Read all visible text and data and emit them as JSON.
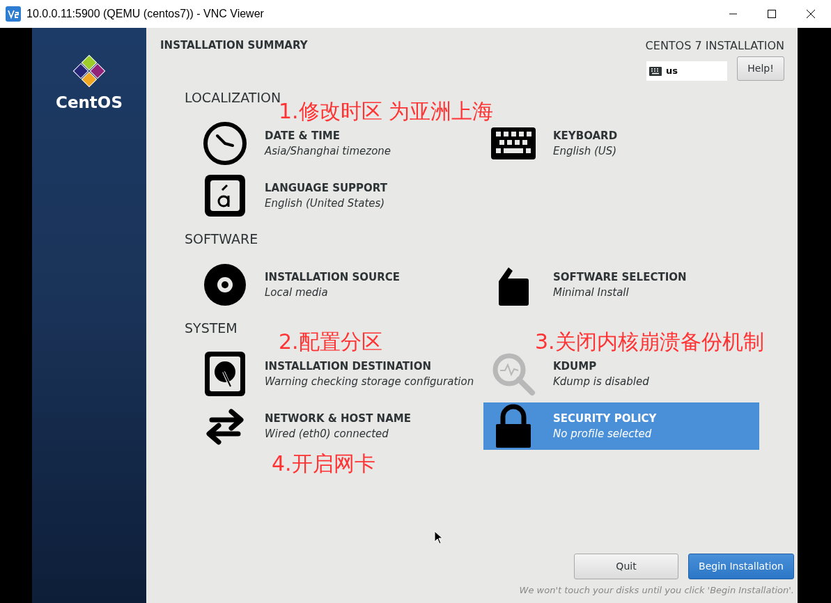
{
  "window": {
    "title": "10.0.0.11:5900 (QEMU (centos7)) - VNC Viewer"
  },
  "sidebar": {
    "logo_text": "CentOS"
  },
  "header": {
    "title": "INSTALLATION SUMMARY",
    "product": "CENTOS 7 INSTALLATION",
    "keyboard_layout": "us",
    "help_button": "Help!"
  },
  "sections": [
    {
      "heading": "LOCALIZATION",
      "items": [
        {
          "kind": "clock",
          "title": "DATE & TIME",
          "status": "Asia/Shanghai timezone",
          "disabled": false,
          "selected": false,
          "annotation": "1.修改时区 为亚洲上海"
        },
        {
          "kind": "keyboard",
          "title": "KEYBOARD",
          "status": "English (US)",
          "disabled": false,
          "selected": false
        },
        {
          "kind": "language",
          "title": "LANGUAGE SUPPORT",
          "status": "English (United States)",
          "disabled": false,
          "selected": false
        }
      ]
    },
    {
      "heading": "SOFTWARE",
      "items": [
        {
          "kind": "disc",
          "title": "INSTALLATION SOURCE",
          "status": "Local media",
          "disabled": false,
          "selected": false
        },
        {
          "kind": "package",
          "title": "SOFTWARE SELECTION",
          "status": "Minimal Install",
          "disabled": false,
          "selected": false
        }
      ]
    },
    {
      "heading": "SYSTEM",
      "items": [
        {
          "kind": "disk",
          "title": "INSTALLATION DESTINATION",
          "status": "Warning checking storage configuration",
          "disabled": false,
          "selected": false,
          "annotation": "2.配置分区"
        },
        {
          "kind": "search",
          "title": "KDUMP",
          "status": "Kdump is disabled",
          "disabled": true,
          "selected": false,
          "annotation": "3.关闭内核崩溃备份机制"
        },
        {
          "kind": "network",
          "title": "NETWORK & HOST NAME",
          "status": "Wired (eth0) connected",
          "disabled": false,
          "selected": false,
          "annotation": "4.开启网卡"
        },
        {
          "kind": "lock",
          "title": "SECURITY POLICY",
          "status": "No profile selected",
          "disabled": false,
          "selected": true
        }
      ]
    }
  ],
  "footer": {
    "quit_button": "Quit",
    "begin_button": "Begin Installation",
    "note": "We won't touch your disks until you click 'Begin Installation'."
  }
}
